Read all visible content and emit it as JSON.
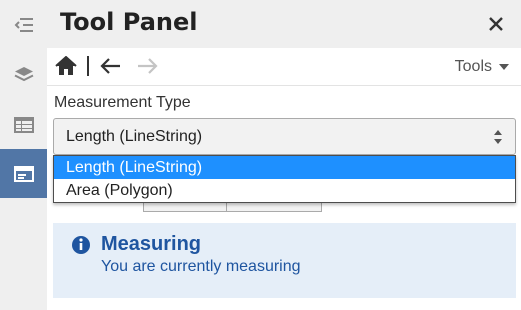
{
  "header": {
    "title": "Tool Panel"
  },
  "rail": {
    "items": [
      {
        "icon": "collapse-arrow-icon"
      },
      {
        "icon": "layers-icon"
      },
      {
        "icon": "table-icon"
      },
      {
        "icon": "tool-panel-icon",
        "active": true
      }
    ]
  },
  "nav": {
    "tools_label": "Tools"
  },
  "measurement": {
    "label": "Measurement Type",
    "selected": "Length (LineString)",
    "options": [
      "Length (LineString)",
      "Area (Polygon)"
    ]
  },
  "alert": {
    "title": "Measuring",
    "message": "You are currently measuring"
  },
  "colors": {
    "accent": "#5176a6",
    "selected_option": "#1e90ff",
    "alert_text": "#1f55a0",
    "alert_bg": "#e5eef8"
  }
}
